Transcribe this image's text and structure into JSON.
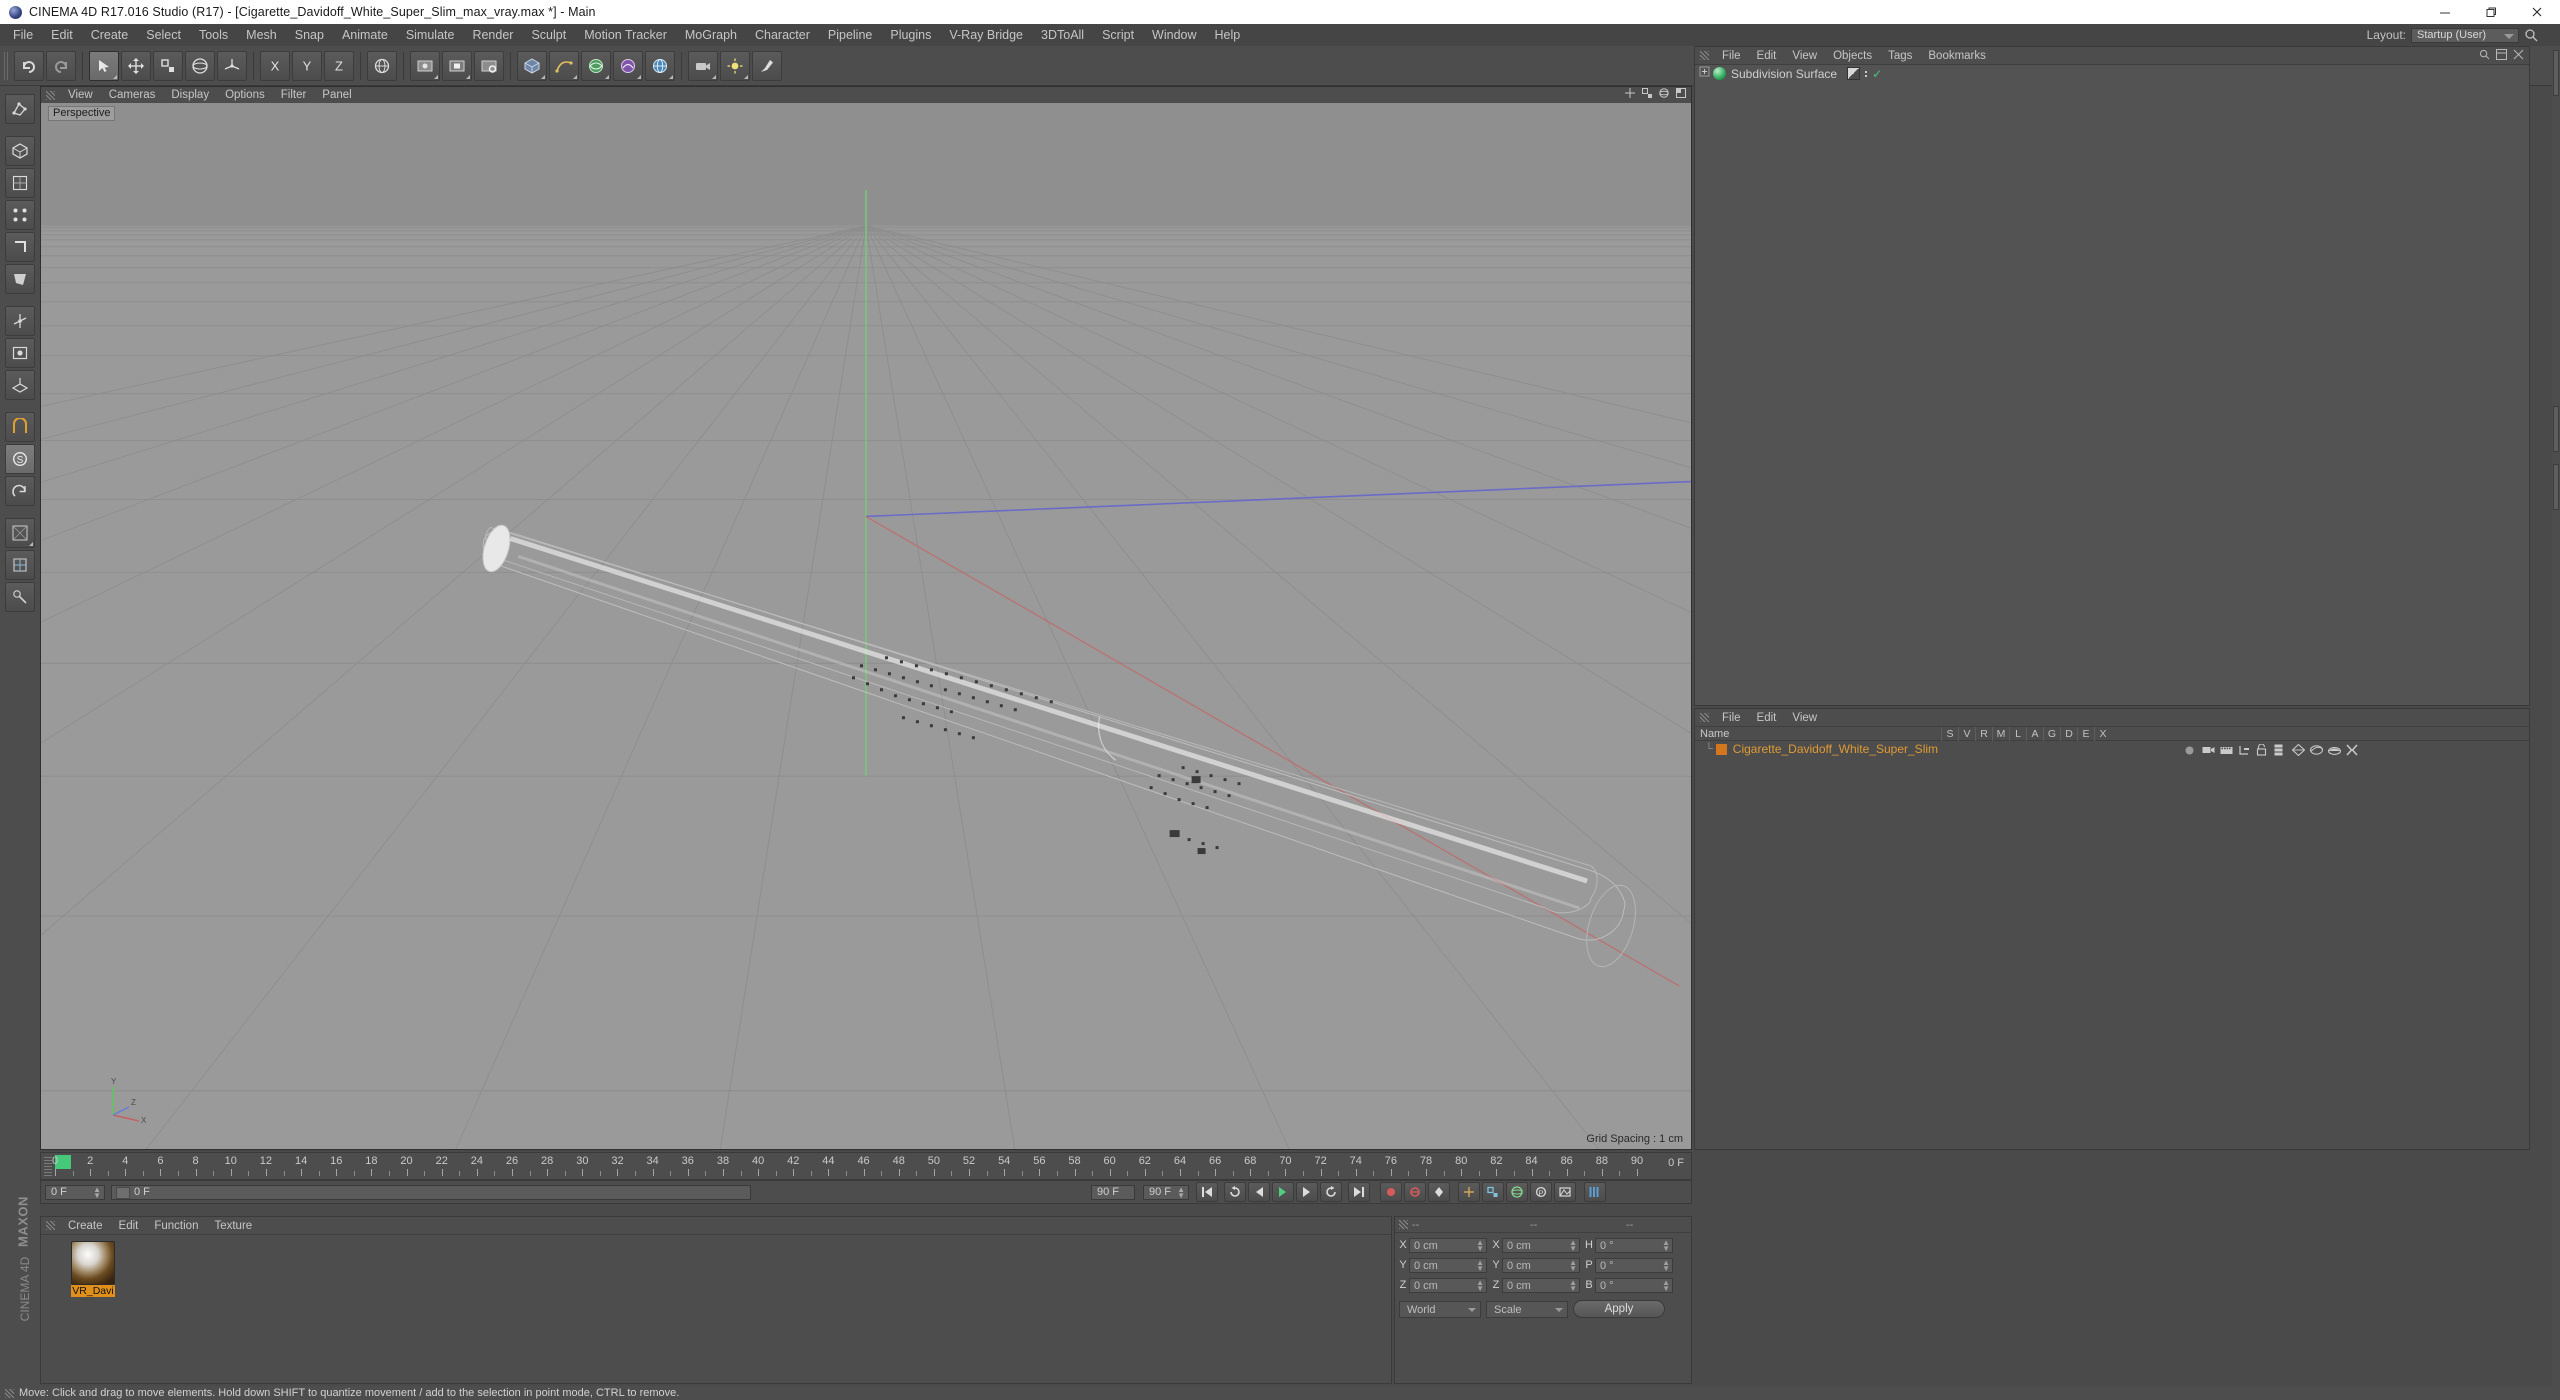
{
  "window": {
    "title": "CINEMA 4D R17.016 Studio (R17) - [Cigarette_Davidoff_White_Super_Slim_max_vray.max *] - Main",
    "app_icon": "c4d-logo-icon",
    "controls": {
      "minimize": "minimize-icon",
      "maximize": "maximize-icon",
      "close": "close-icon"
    }
  },
  "menubar": {
    "items": [
      "File",
      "Edit",
      "Create",
      "Select",
      "Tools",
      "Mesh",
      "Snap",
      "Animate",
      "Simulate",
      "Render",
      "Sculpt",
      "Motion Tracker",
      "MoGraph",
      "Character",
      "Pipeline",
      "Plugins",
      "V-Ray Bridge",
      "3DToAll",
      "Script",
      "Window",
      "Help"
    ],
    "layout_label": "Layout:",
    "layout_value": "Startup (User)",
    "search_icon": "magnifier-icon"
  },
  "toolbar": {
    "buttons": [
      "undo-icon",
      "redo-icon",
      "live-selection-icon",
      "move-icon",
      "scale-icon",
      "rotate-icon",
      "world-object-axis-icon",
      "lock-x-axis-icon",
      "lock-y-axis-icon",
      "lock-z-axis-icon",
      "world-coordinate-icon",
      "render-view-icon",
      "render-region-icon",
      "render-settings-icon",
      "cube-primitive-icon",
      "spline-pen-icon",
      "generator-icon",
      "deformer-icon",
      "environment-icon",
      "camera-icon",
      "light-icon",
      "sculpt-brush-icon"
    ]
  },
  "left_palette": {
    "buttons": [
      "make-editable-icon",
      "model-mode-icon",
      "texture-mode-icon",
      "points-mode-icon",
      "edges-mode-icon",
      "polygons-mode-icon",
      "enable-axis-icon",
      "viewport-solo-icon",
      "workplane-icon",
      "snap-toggle-icon",
      "quantize-icon",
      "workplane-lock-icon",
      "texture-axis-icon",
      "uv-mode-icon",
      "tweak-mode-icon"
    ]
  },
  "viewport": {
    "menu": [
      "View",
      "Cameras",
      "Display",
      "Options",
      "Filter",
      "Panel"
    ],
    "view_label": "Perspective",
    "grid_spacing": "Grid Spacing : 1 cm",
    "panel_icons": [
      "move-view-icon",
      "scale-view-icon",
      "rotate-view-icon",
      "maximize-view-icon"
    ],
    "axis_gizmo": {
      "y": "Y",
      "x": "X",
      "z": "Z"
    }
  },
  "object_manager": {
    "menu": [
      "File",
      "Edit",
      "View",
      "Objects",
      "Tags",
      "Bookmarks"
    ],
    "right_icons": [
      "search-icon",
      "layout-icon",
      "close-icon"
    ],
    "rows": [
      {
        "name": "Subdivision Surface",
        "icon": "subdivision-surface-icon",
        "tags": [
          "phong-tag-icon",
          "visibility-dots-icon",
          "enabled-check-icon"
        ]
      }
    ]
  },
  "structure_manager": {
    "menu": [
      "File",
      "Edit",
      "View"
    ],
    "name_column": "Name",
    "columns": [
      "S",
      "V",
      "R",
      "M",
      "L",
      "A",
      "G",
      "D",
      "E",
      "X"
    ],
    "rows": [
      {
        "name": "Cigarette_Davidoff_White_Super_Slim",
        "color": "#e09a34",
        "icons": [
          "sphere-icon",
          "camera-icon",
          "render-icon",
          "hierarchy-icon",
          "lock-icon",
          "layer-icon",
          "generator-icon",
          "deform-icon",
          "display-icon",
          "xpresso-icon"
        ]
      }
    ]
  },
  "timeline": {
    "labels": [
      "0",
      "2",
      "4",
      "6",
      "8",
      "10",
      "12",
      "14",
      "16",
      "18",
      "20",
      "22",
      "24",
      "26",
      "28",
      "30",
      "32",
      "34",
      "36",
      "38",
      "40",
      "42",
      "44",
      "46",
      "48",
      "50",
      "52",
      "54",
      "56",
      "58",
      "60",
      "62",
      "64",
      "66",
      "68",
      "70",
      "72",
      "74",
      "76",
      "78",
      "80",
      "82",
      "84",
      "86",
      "88",
      "90"
    ],
    "end_label": "0 F",
    "current_frame": "0 F",
    "preview_range_start": "0 F",
    "range_end": "90 F",
    "frame_end_field": "90 F",
    "playhead_frame": 0,
    "transport": [
      "go-to-start-icon",
      "step-back-icon",
      "play-back-icon",
      "play-icon",
      "step-forward-icon",
      "go-to-end-icon",
      "loop-icon"
    ],
    "record_tools": [
      "record-icon",
      "autokey-icon",
      "keyframe-selection-icon",
      "position-key-icon",
      "scale-key-icon",
      "rotation-key-icon",
      "param-key-icon",
      "pla-key-icon",
      "timeline-icon"
    ]
  },
  "material_manager": {
    "menu": [
      "Create",
      "Edit",
      "Function",
      "Texture"
    ],
    "materials": [
      {
        "name": "VR_Davi",
        "preview": "brown-white-sphere-preview"
      }
    ]
  },
  "coordinate_manager": {
    "headers": [
      "--",
      "--",
      "--"
    ],
    "position": {
      "label_x": "X",
      "label_y": "Y",
      "label_z": "Z",
      "x": "0 cm",
      "y": "0 cm",
      "z": "0 cm"
    },
    "size": {
      "label_x": "X",
      "label_y": "Y",
      "label_z": "Z",
      "x": "0 cm",
      "y": "0 cm",
      "z": "0 cm"
    },
    "rotation": {
      "label_h": "H",
      "label_p": "P",
      "label_b": "B",
      "h": "0 °",
      "p": "0 °",
      "b": "0 °"
    },
    "coord_system": "World",
    "mode": "Scale",
    "apply_label": "Apply"
  },
  "status_bar": {
    "text": "Move: Click and drag to move elements. Hold down SHIFT to quantize movement / add to the selection in point mode, CTRL to remove."
  },
  "branding": {
    "line1": "MAXON",
    "line2": "CINEMA 4D"
  },
  "colors": {
    "chrome": "#4d4d4d",
    "panel": "#535353",
    "accent_orange": "#e09a34",
    "accent_green": "#46c87a",
    "viewport_bg": "#9a9a9a",
    "text": "#c6c6c6"
  }
}
